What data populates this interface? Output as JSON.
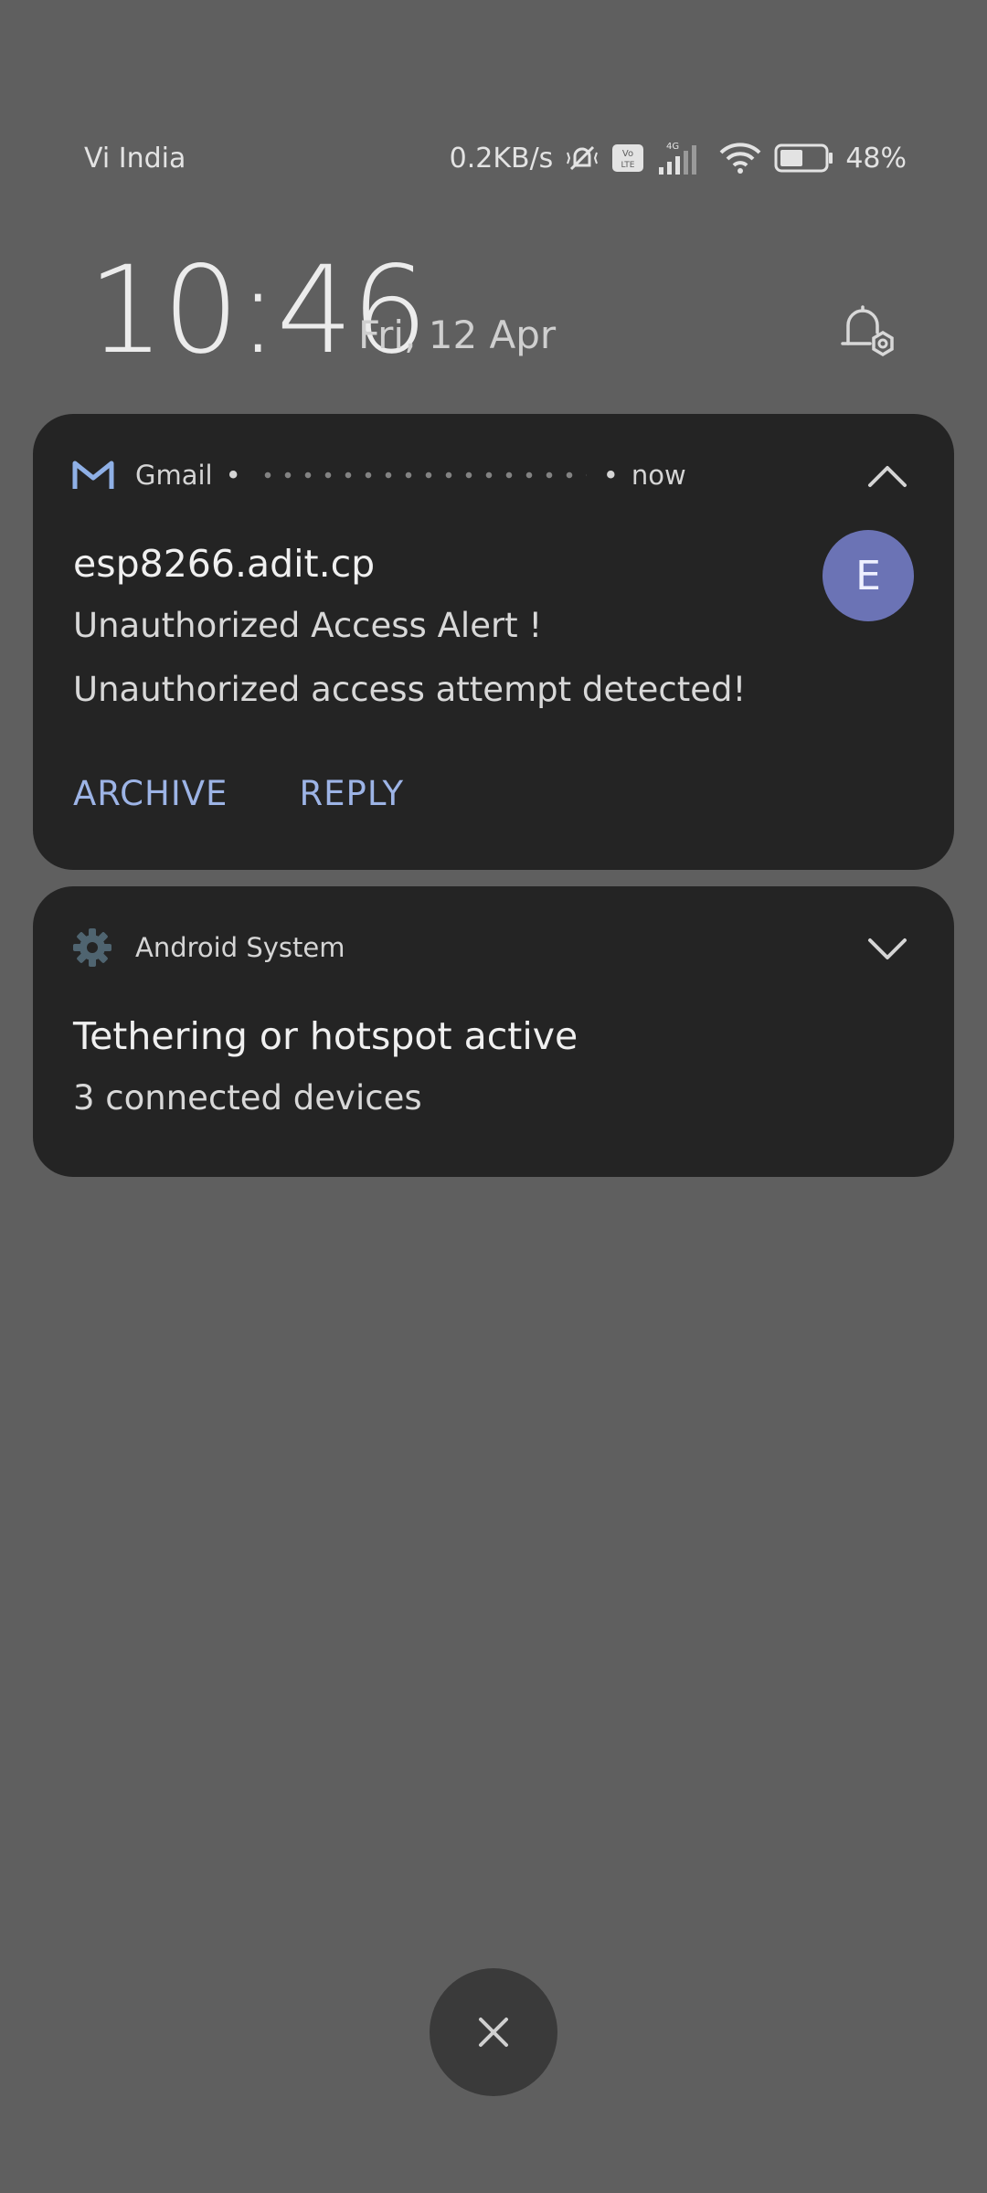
{
  "status_bar": {
    "carrier": "Vi India",
    "net_speed": "0.2KB/s",
    "volte": "Vo LTE",
    "network_type": "4G",
    "battery": "48%",
    "icons": [
      "vibrate-mute-icon",
      "volte-icon",
      "signal-icon",
      "wifi-icon",
      "battery-icon"
    ]
  },
  "clock": {
    "time": "10:46",
    "date": "Fri, 12 Apr"
  },
  "notifications": {
    "gmail": {
      "app_name": "Gmail",
      "separator": "•",
      "time": "now",
      "sender": "esp8266.adit.cp",
      "subject": "Unauthorized Access Alert !",
      "snippet": "Unauthorized access attempt detected!",
      "avatar_letter": "E",
      "actions": {
        "archive": "ARCHIVE",
        "reply": "REPLY"
      }
    },
    "system": {
      "app_name": "Android System",
      "title": "Tethering or hotspot active",
      "subtitle": "3 connected devices"
    }
  },
  "colors": {
    "background": "#5f5f5f",
    "card": "#242424",
    "accent": "#9db4e6",
    "avatar": "#6b73b5"
  }
}
